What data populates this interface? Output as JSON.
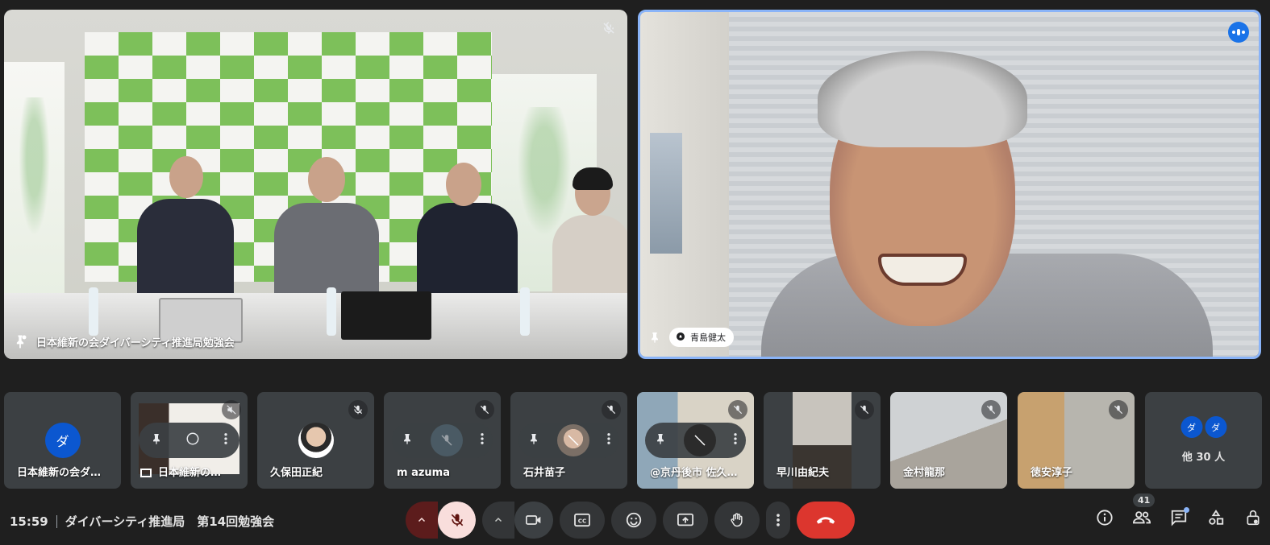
{
  "main_tiles": [
    {
      "name": "日本維新の会ダイバーシティ推進局勉強会"
    },
    {
      "name": "青島健太"
    }
  ],
  "strip": [
    {
      "name": "日本維新の会ダ…",
      "avatar_letter": "ダ"
    },
    {
      "name": "日本維新の…"
    },
    {
      "name": "久保田正紀"
    },
    {
      "name": "m azuma"
    },
    {
      "name": "石井苗子"
    },
    {
      "name": "@京丹後市 佐久…"
    },
    {
      "name": "早川由紀夫"
    },
    {
      "name": "金村龍那"
    },
    {
      "name": "徳安淳子"
    },
    {
      "more_letters": [
        "ダ",
        "ダ"
      ],
      "label": "他 30 人"
    }
  ],
  "bottom": {
    "time": "15:59",
    "meeting_title": "ダイバーシティ推進局　第14回勉強会",
    "participants_count": "41"
  },
  "colors": {
    "background": "#1f1f1f",
    "active_speaker_border": "#8ab4f8",
    "hangup": "#dc362e",
    "mic_off": "#f9dedc",
    "avatar": "#0b57d0"
  }
}
